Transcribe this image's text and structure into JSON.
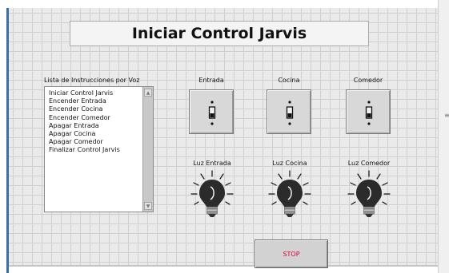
{
  "title": "Iniciar Control Jarvis",
  "instructions": {
    "label": "Lista de Instrucciones por Voz",
    "items": [
      "Iniciar Control Jarvis",
      "Encender Entrada",
      "Encender Cocina",
      "Encender Comedor",
      "Apagar Entrada",
      "Apagar Cocina",
      "Apagar Comedor",
      "Finalizar Control Jarvis"
    ]
  },
  "switches": [
    {
      "label": "Entrada",
      "state": "off"
    },
    {
      "label": "Cocina",
      "state": "off"
    },
    {
      "label": "Comedor",
      "state": "off"
    }
  ],
  "lights": [
    {
      "label": "Luz Entrada",
      "state": "off"
    },
    {
      "label": "Luz Cocina",
      "state": "off"
    },
    {
      "label": "Luz Comedor",
      "state": "off"
    }
  ],
  "stop_button": {
    "label": "STOP"
  },
  "colors": {
    "stop_text": "#e0003a",
    "panel_bg": "#eaeaea",
    "grid": "#cfcfcf",
    "accent_border": "#3a6ea5"
  }
}
